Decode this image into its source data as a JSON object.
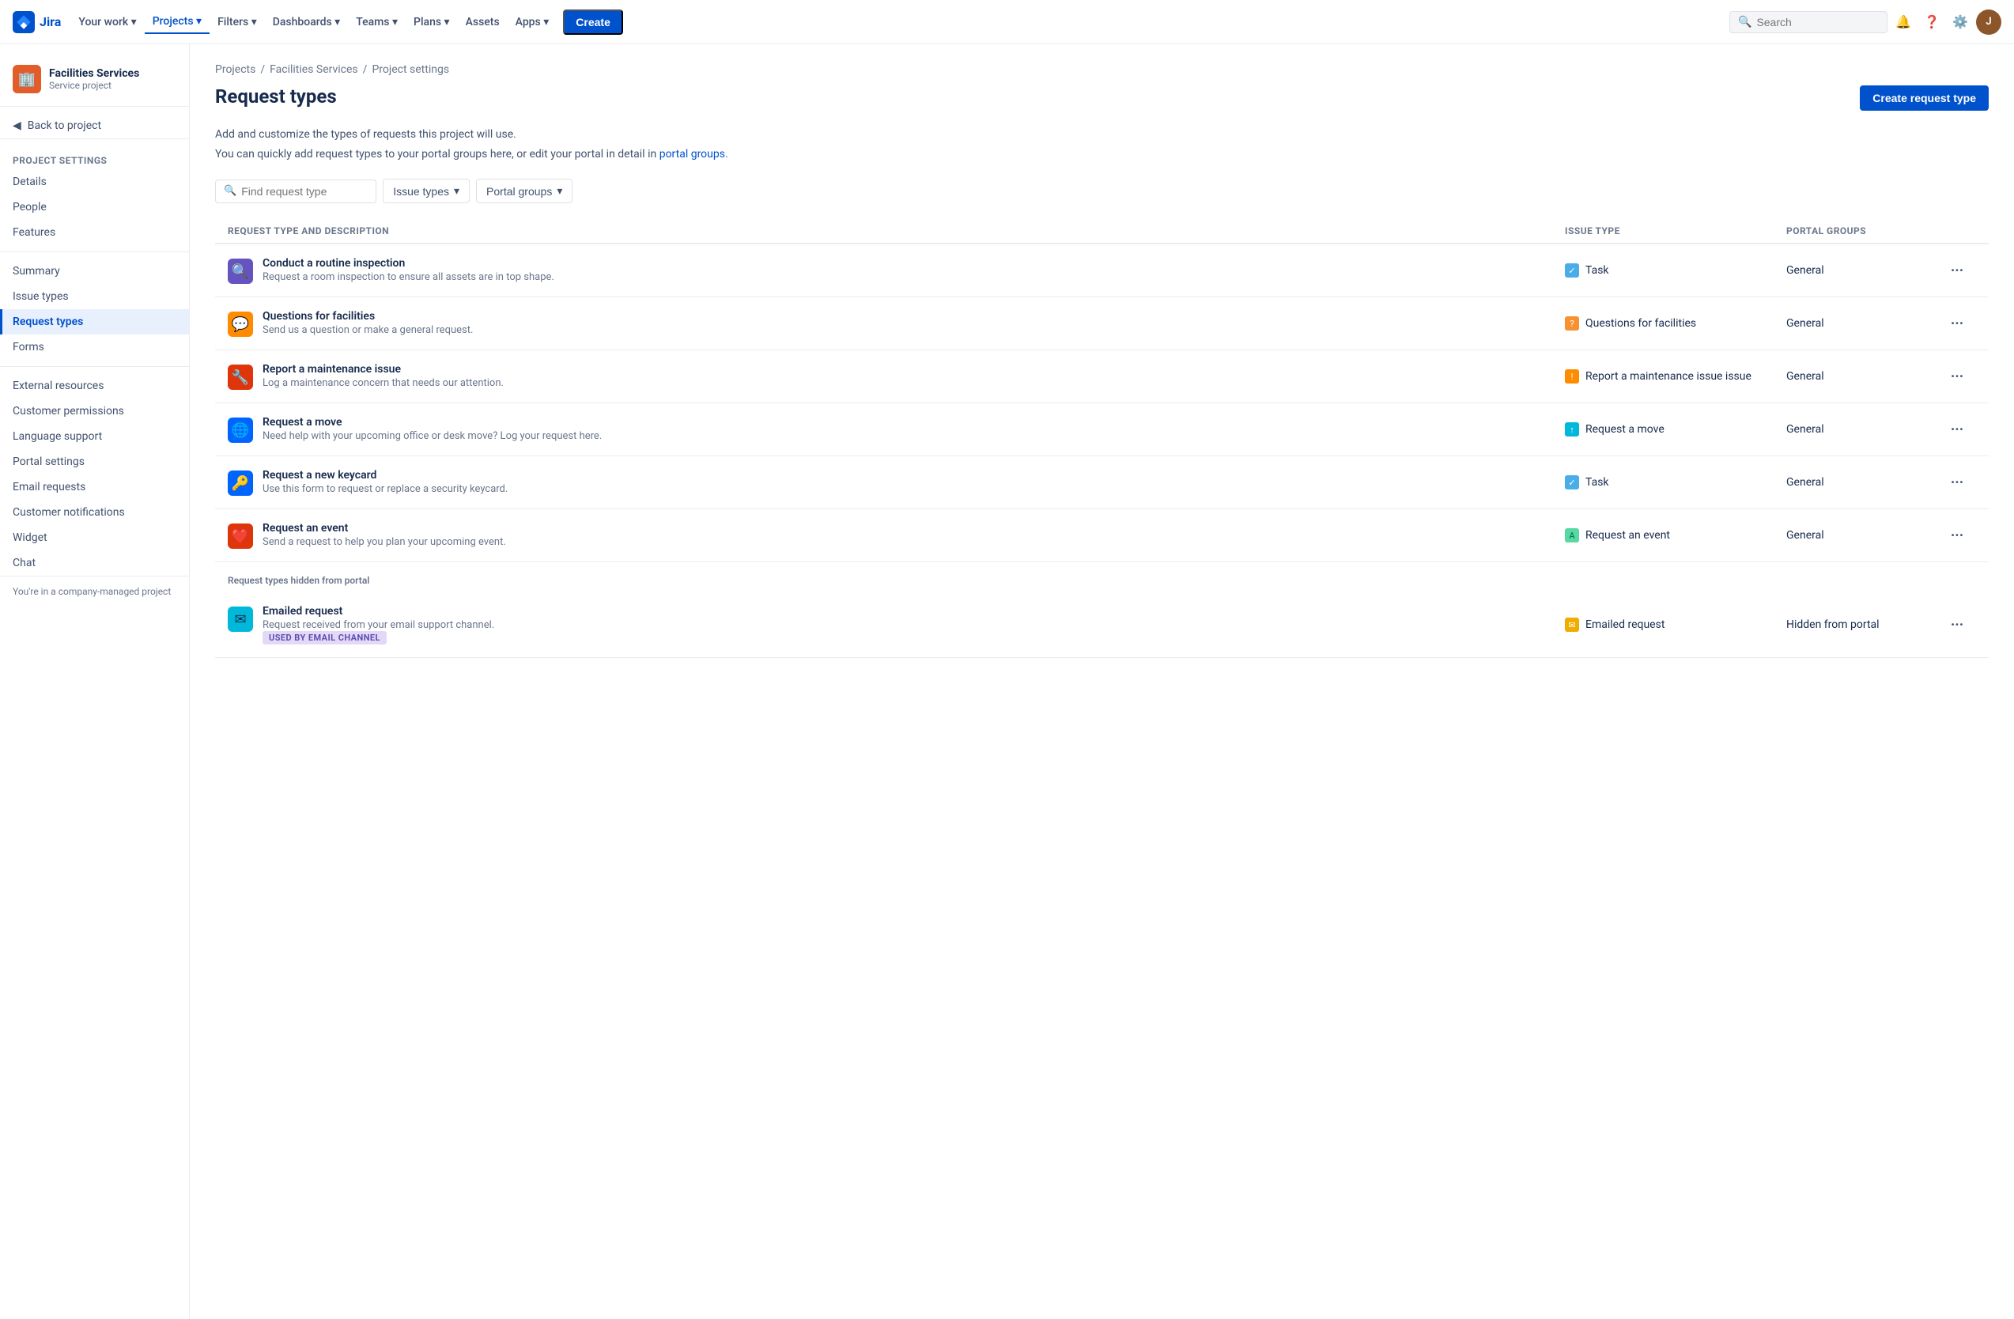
{
  "nav": {
    "logo_text": "Jira",
    "items": [
      {
        "label": "Your work",
        "has_chevron": true,
        "active": false
      },
      {
        "label": "Projects",
        "has_chevron": true,
        "active": true
      },
      {
        "label": "Filters",
        "has_chevron": true,
        "active": false
      },
      {
        "label": "Dashboards",
        "has_chevron": true,
        "active": false
      },
      {
        "label": "Teams",
        "has_chevron": true,
        "active": false
      },
      {
        "label": "Plans",
        "has_chevron": true,
        "active": false
      },
      {
        "label": "Assets",
        "has_chevron": false,
        "active": false
      },
      {
        "label": "Apps",
        "has_chevron": true,
        "active": false
      }
    ],
    "create_label": "Create",
    "search_placeholder": "Search"
  },
  "sidebar": {
    "project_name": "Facilities Services",
    "project_type": "Service project",
    "back_label": "Back to project",
    "section_title": "Project settings",
    "items": [
      {
        "label": "Details",
        "active": false
      },
      {
        "label": "People",
        "active": false
      },
      {
        "label": "Features",
        "active": false
      },
      {
        "label": "Summary",
        "active": false
      },
      {
        "label": "Issue types",
        "active": false
      },
      {
        "label": "Request types",
        "active": true
      },
      {
        "label": "Forms",
        "active": false
      },
      {
        "label": "External resources",
        "active": false
      },
      {
        "label": "Customer permissions",
        "active": false
      },
      {
        "label": "Language support",
        "active": false
      },
      {
        "label": "Portal settings",
        "active": false
      },
      {
        "label": "Email requests",
        "active": false
      },
      {
        "label": "Customer notifications",
        "active": false
      },
      {
        "label": "Widget",
        "active": false
      },
      {
        "label": "Chat",
        "active": false
      }
    ],
    "company_note": "You're in a company-managed project"
  },
  "breadcrumb": {
    "items": [
      {
        "label": "Projects",
        "href": true
      },
      {
        "label": "Facilities Services",
        "href": true
      },
      {
        "label": "Project settings",
        "href": true
      }
    ]
  },
  "page": {
    "title": "Request types",
    "create_btn": "Create request type",
    "desc1": "Add and customize the types of requests this project will use.",
    "desc2": "You can quickly add request types to your portal groups here, or edit your portal in detail in",
    "portal_link": "portal groups",
    "desc2_end": "."
  },
  "filters": {
    "search_placeholder": "Find request type",
    "issue_types_label": "Issue types",
    "portal_groups_label": "Portal groups"
  },
  "table": {
    "col1": "Request type and description",
    "col2": "Issue type",
    "col3": "Portal groups",
    "col4": ""
  },
  "request_types": [
    {
      "name": "Conduct a routine inspection",
      "desc": "Request a room inspection to ensure all assets are in top shape.",
      "icon": "🔍",
      "icon_bg": "#6554c0",
      "issue_type_icon": "✓",
      "issue_type_icon_bg": "#4bade8",
      "issue_type": "Task",
      "portal_group": "General"
    },
    {
      "name": "Questions for facilities",
      "desc": "Send us a question or make a general request.",
      "icon": "💬",
      "icon_bg": "#ff8b00",
      "issue_type_icon": "?",
      "issue_type_icon_bg": "#f79232",
      "issue_type": "Questions for facilities",
      "portal_group": "General"
    },
    {
      "name": "Report a maintenance issue",
      "desc": "Log a maintenance concern that needs our attention.",
      "icon": "🔧",
      "icon_bg": "#ff5630",
      "issue_type_icon": "!",
      "issue_type_icon_bg": "#ff8b00",
      "issue_type": "Report a maintenance issue",
      "issue_type_line2": "issue",
      "portal_group": "General"
    },
    {
      "name": "Request a move",
      "desc": "Need help with your upcoming office or desk move? Log your request here.",
      "icon": "🌐",
      "icon_bg": "#00b8d9",
      "issue_type_icon": "↑",
      "issue_type_icon_bg": "#00b8d9",
      "issue_type": "Request a move",
      "portal_group": "General"
    },
    {
      "name": "Request a new keycard",
      "desc": "Use this form to request or replace a security keycard.",
      "icon": "🔑",
      "icon_bg": "#0065ff",
      "issue_type_icon": "✓",
      "issue_type_icon_bg": "#4bade8",
      "issue_type": "Task",
      "portal_group": "General"
    },
    {
      "name": "Request an event",
      "desc": "Send a request to help you plan your upcoming event.",
      "icon": "❤️",
      "icon_bg": "#de350b",
      "issue_type_icon": "A",
      "issue_type_icon_bg": "#57d9a3",
      "issue_type": "Request an event",
      "portal_group": "General"
    }
  ],
  "hidden_section": {
    "label": "Request types hidden from portal"
  },
  "hidden_types": [
    {
      "name": "Emailed request",
      "desc": "Request received from your email support channel.",
      "icon": "✉",
      "icon_bg": "#00b8d9",
      "issue_type_icon": "✉",
      "issue_type_icon_bg": "#f0ad00",
      "issue_type": "Emailed request",
      "portal_group": "Hidden from portal",
      "badge": "USED BY EMAIL CHANNEL",
      "badge_class": "badge-purple"
    }
  ]
}
